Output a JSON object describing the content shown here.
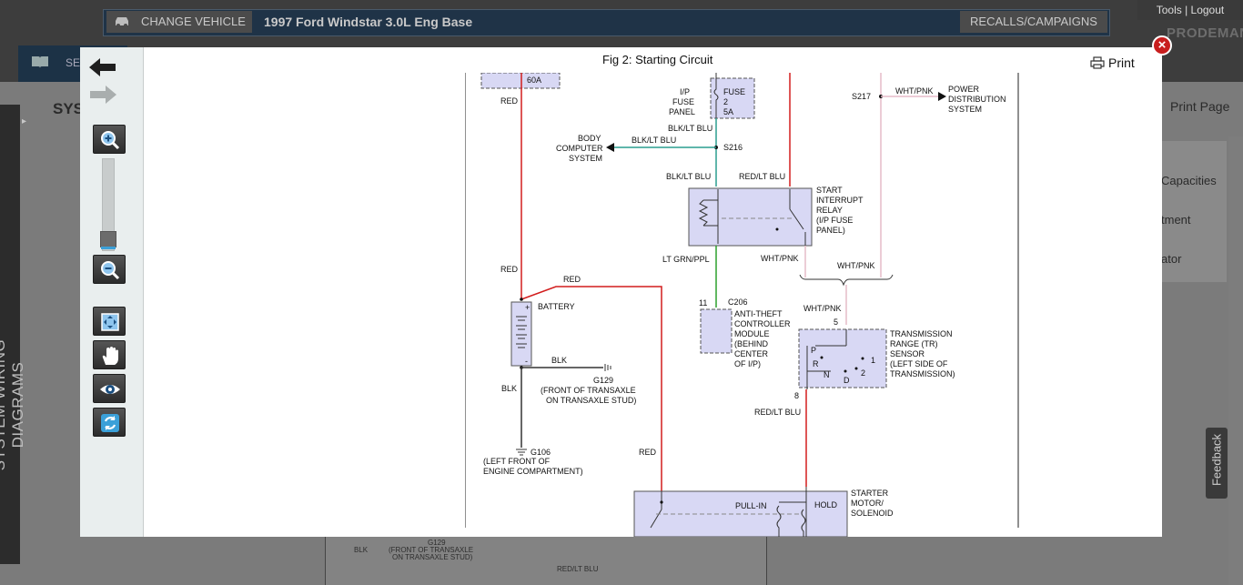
{
  "header": {
    "change_vehicle_label": "CHANGE VEHICLE",
    "vehicle_name": "1997 Ford Windstar 3.0L Eng Base",
    "recalls_label": "RECALLS/CAMPAIGNS",
    "tools_label": "Tools | Logout",
    "brand": "PRODEMAND",
    "nav_label": "SE"
  },
  "page": {
    "heading": "SYS",
    "print_page_label": "Print Page",
    "side_tab_label": "SYSTEM WIRING DIAGRAMS",
    "right_items": [
      "Capacities",
      "tment",
      "ator"
    ],
    "feedback_label": "Feedback",
    "bg_labels": [
      "G129",
      "(FRONT OF TRANSAXLE",
      "ON TRANSAXLE STUD)",
      "BLK",
      "RED/LT BLU"
    ]
  },
  "modal": {
    "title": "Fig 2: Starting Circuit",
    "print_label": "Print",
    "close_symbol": "×"
  },
  "diagram": {
    "fuse_60a": "60A",
    "ip_fuse_panel": [
      "I/P",
      "FUSE",
      "PANEL"
    ],
    "fuse_label": [
      "FUSE",
      "2",
      "5A"
    ],
    "s217": "S217",
    "wht_pnk": "WHT/PNK",
    "power_distribution": [
      "POWER",
      "DISTRIBUTION",
      "SYSTEM"
    ],
    "red": "RED",
    "blk_lt_blu": "BLK/LT BLU",
    "body_computer": [
      "BODY",
      "COMPUTER",
      "SYSTEM"
    ],
    "s216": "S216",
    "red_lt_blu": "RED/LT BLU",
    "start_interrupt": [
      "START",
      "INTERRUPT",
      "RELAY",
      "(I/P FUSE",
      "PANEL)"
    ],
    "lt_grn_ppl": "LT GRN/PPL",
    "battery": "BATTERY",
    "pin_11": "11",
    "c206": "C206",
    "anti_theft": [
      "ANTI-THEFT",
      "CONTROLLER",
      "MODULE",
      "(BEHIND",
      "CENTER",
      "OF I/P)"
    ],
    "pin_5": "5",
    "pin_8": "8",
    "transmission_range": [
      "TRANSMISSION",
      "RANGE (TR)",
      "SENSOR",
      "(LEFT SIDE OF",
      "TRANSMISSION)"
    ],
    "tr_letters": [
      "P",
      "R",
      "N",
      "D",
      "1",
      "2"
    ],
    "blk": "BLK",
    "g129": "G129",
    "g129_loc": [
      "(FRONT OF TRANSAXLE",
      "ON TRANSAXLE STUD)"
    ],
    "g106": "G106",
    "g106_loc": [
      "(LEFT FRONT OF",
      "ENGINE COMPARTMENT)"
    ],
    "pull_in": "PULL-IN",
    "hold": "HOLD",
    "starter": [
      "STARTER",
      "MOTOR/",
      "SOLENOID"
    ],
    "plus_sign": "+",
    "minus_sign": "-"
  }
}
